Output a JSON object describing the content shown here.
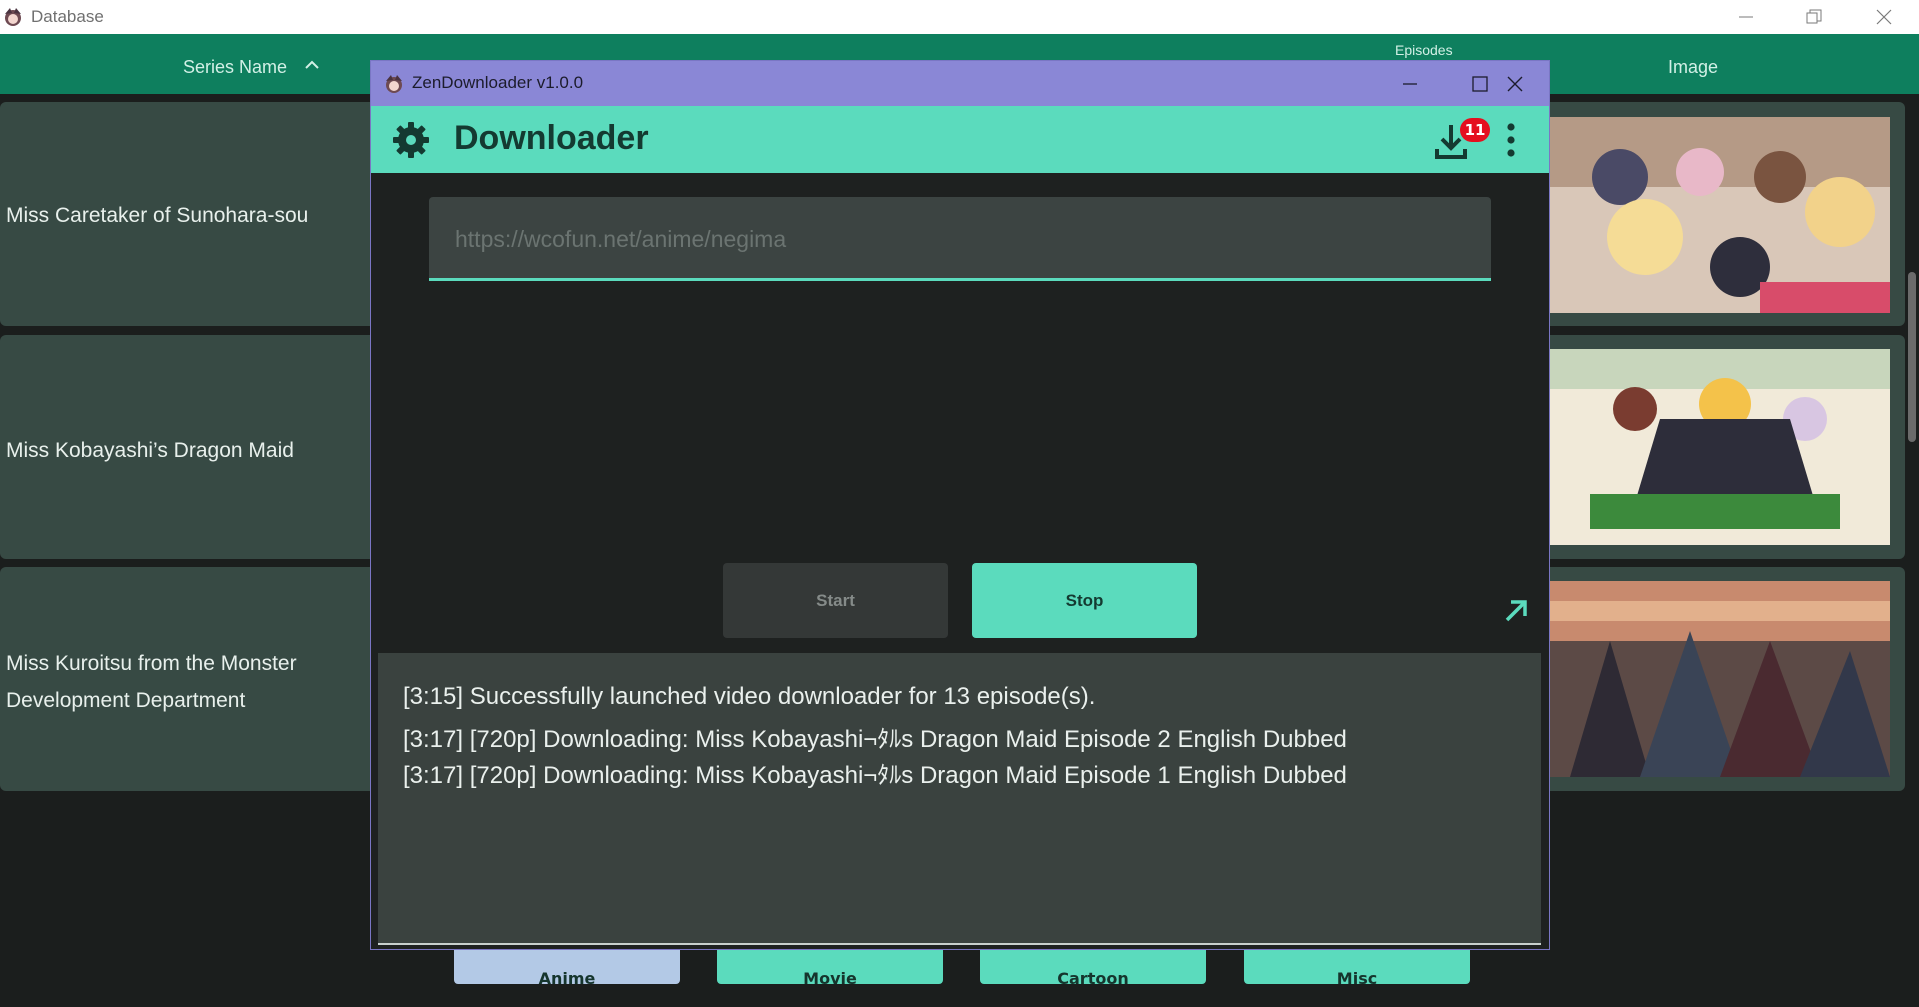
{
  "background_window": {
    "title": "Database",
    "columns": [
      {
        "label": "Series Name"
      },
      {
        "label": ""
      },
      {
        "label": ""
      },
      {
        "label": "Episodes"
      },
      {
        "label": "Image"
      }
    ],
    "rows": [
      {
        "name": "Miss Caretaker of Sunohara-sou"
      },
      {
        "name": "Miss Kobayashi’s Dragon Maid"
      },
      {
        "name": "Miss Kuroitsu from the Monster Development Department"
      }
    ],
    "categories": [
      {
        "label": "Anime",
        "active": true
      },
      {
        "label": "Movie",
        "active": false
      },
      {
        "label": "Cartoon",
        "active": false
      },
      {
        "label": "Misc",
        "active": false
      }
    ]
  },
  "downloader_window": {
    "title": "ZenDownloader v1.0.0",
    "appbar_title": "Downloader",
    "download_badge": "11",
    "url_placeholder": "https://wcofun.net/anime/negima",
    "start_label": "Start",
    "stop_label": "Stop",
    "log_lines": [
      "[3:15] Successfully launched video downloader for 13 episode(s).",
      "[3:17] [720p] Downloading: Miss Kobayashi¬ﾀﾙs Dragon Maid Episode 2 English Dubbed",
      "[3:17] [720p] Downloading: Miss Kobayashi¬ﾀﾙs Dragon Maid Episode 1 English Dubbed"
    ]
  },
  "colors": {
    "accent": "#5bdbbd",
    "header_green": "#0e7f5e",
    "title_purple": "#8a87d6",
    "badge_red": "#e50f1f",
    "log_bg": "#3a423f"
  },
  "icons": {
    "app": "app-logo-icon",
    "settings": "gear-icon",
    "download": "download-icon",
    "more": "more-vertical-icon",
    "expand": "arrow-up-right-icon"
  }
}
